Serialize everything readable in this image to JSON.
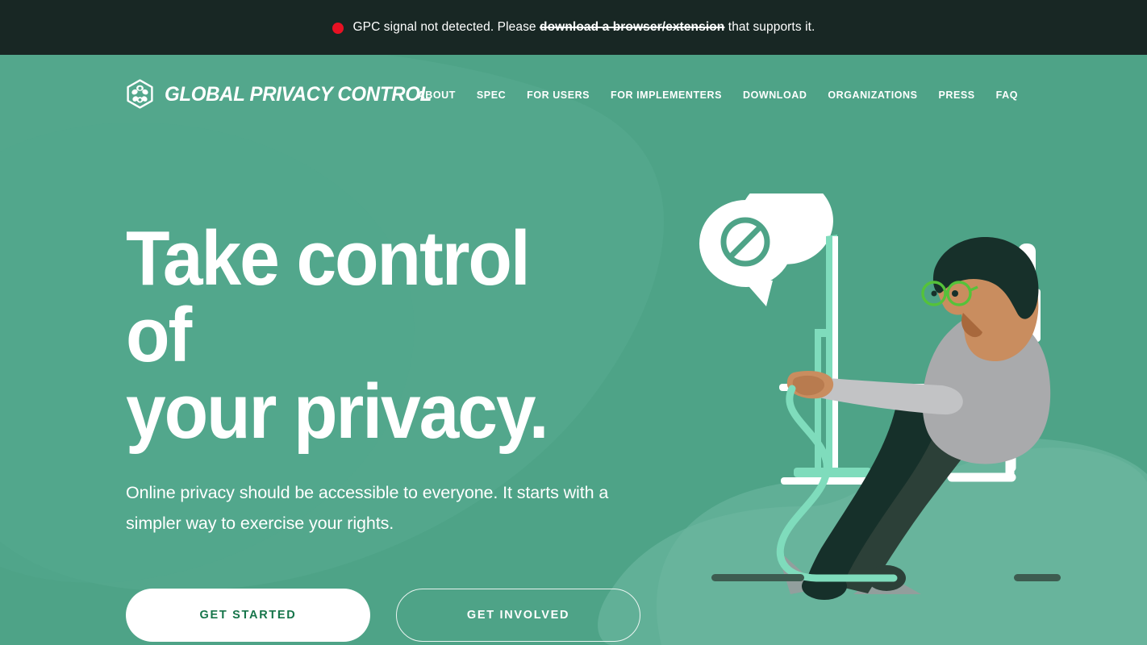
{
  "alert": {
    "status_icon": "red-dot-icon",
    "text_before": "GPC signal not detected. Please ",
    "link_label": "download a browser/extension",
    "text_after": " that supports it.",
    "dot_color": "#e81123",
    "bar_color": "#182724"
  },
  "header": {
    "logo_icon": "gpc-hexagon-logo-icon",
    "brand_name": "GLOBAL PRIVACY CONTROL",
    "nav": [
      {
        "label": "ABOUT"
      },
      {
        "label": "SPEC"
      },
      {
        "label": "FOR USERS"
      },
      {
        "label": "FOR IMPLEMENTERS"
      },
      {
        "label": "DOWNLOAD"
      },
      {
        "label": "ORGANIZATIONS"
      },
      {
        "label": "PRESS"
      },
      {
        "label": "FAQ"
      }
    ]
  },
  "hero": {
    "headline": "Take control of\nyour privacy.",
    "subhead": "Online privacy should be accessible to everyone. It starts with a simpler way to exercise your rights.",
    "primary_cta": "GET STARTED",
    "secondary_cta": "GET INVOLVED",
    "illustration_name": "person-at-computer-with-blocked-tracking-bubble"
  },
  "colors": {
    "background_green": "#4ea387",
    "blob_light": "#5cad93",
    "blob_lighter": "#69b59d",
    "banner_dark": "#182724",
    "mint": "#7fdcbc",
    "white": "#ffffff",
    "primary_text_green": "#16754a",
    "ground_line": "#3d5c50",
    "glasses_green": "#55c23a",
    "hair_dark": "#17302a",
    "sweater_gray": "#a9aaac",
    "skin": "#c98d5f"
  }
}
